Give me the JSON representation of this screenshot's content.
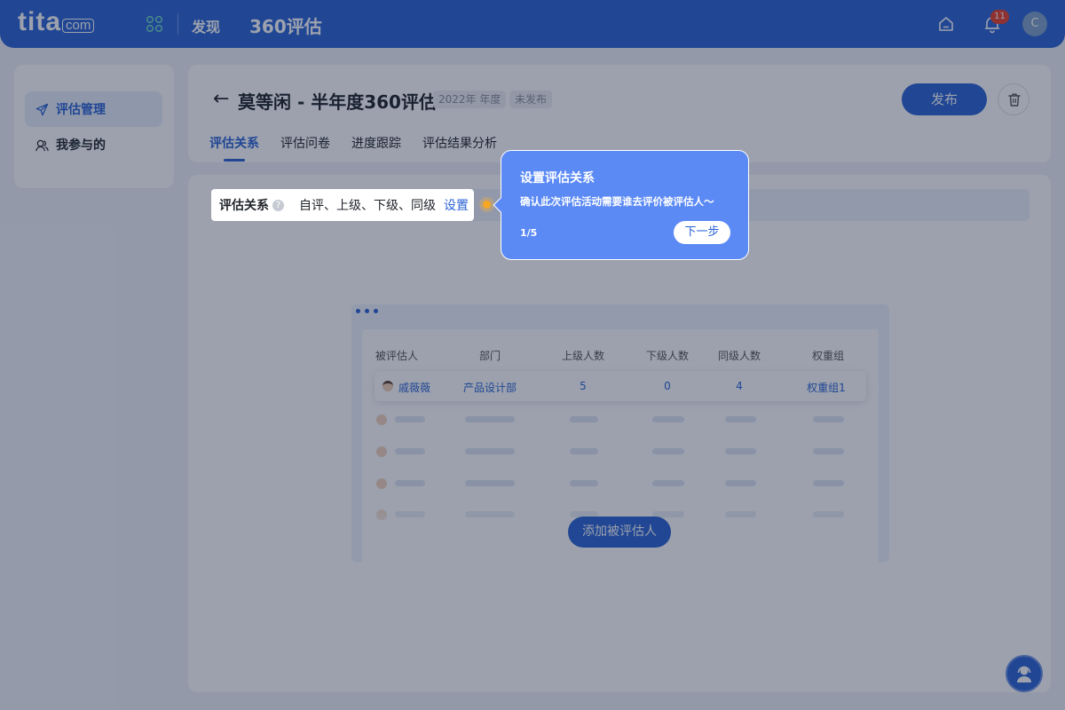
{
  "topbar": {
    "logo_main": "tita",
    "logo_com": "com",
    "nav_discover": "发现",
    "nav_360": "360评估",
    "bell_badge": "11",
    "avatar_letter": "C"
  },
  "sidebar": {
    "items": [
      {
        "label": "评估管理",
        "icon": "paper-plane-icon",
        "active": true
      },
      {
        "label": "我参与的",
        "icon": "people-icon",
        "active": false
      }
    ]
  },
  "header": {
    "title": "莫等闲 - 半年度360评估",
    "tag_year": "2022年 年度",
    "tag_status": "未发布",
    "publish_label": "发布",
    "tabs": [
      {
        "label": "评估关系",
        "active": true
      },
      {
        "label": "评估问卷",
        "active": false
      },
      {
        "label": "进度跟踪",
        "active": false
      },
      {
        "label": "评估结果分析",
        "active": false
      }
    ]
  },
  "relation": {
    "label": "评估关系",
    "help": "?",
    "value": "自评、上级、下级、同级",
    "action": "设置"
  },
  "table": {
    "headers": [
      "被评估人",
      "部门",
      "上级人数",
      "下级人数",
      "同级人数",
      "权重组"
    ],
    "highlight_row": {
      "name": "戚薇薇",
      "department": "产品设计部",
      "superiors": "5",
      "subordinates": "0",
      "peers": "4",
      "weight_group": "权重组1"
    }
  },
  "add_button": "添加被评估人",
  "tooltip": {
    "title": "设置评估关系",
    "body": "确认此次评估活动需要谁去评价被评估人～",
    "step": "1/5",
    "next": "下一步"
  },
  "colors": {
    "primary": "#2a63d4",
    "tooltip_bg": "#5b8af5",
    "badge": "#e8402b",
    "pulse": "#f6a623"
  }
}
